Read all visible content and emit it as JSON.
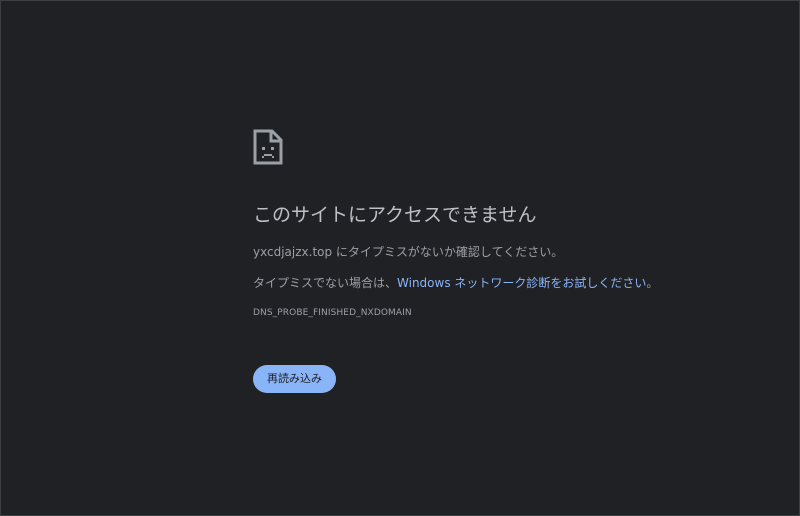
{
  "error": {
    "icon": "sad-document-icon",
    "title": "このサイトにアクセスできません",
    "message_domain": "yxcdjajzx.top",
    "message_suffix": " にタイプミスがないか確認してください。",
    "hint_prefix": "タイプミスでない場合は、",
    "hint_link": "Windows ネットワーク診断をお試しください",
    "hint_suffix": "。",
    "error_code": "DNS_PROBE_FINISHED_NXDOMAIN"
  },
  "actions": {
    "reload_label": "再読み込み"
  },
  "colors": {
    "background": "#202124",
    "text": "#9aa0a6",
    "title": "#bdc1c6",
    "link": "#8ab4f8",
    "button": "#8ab4f8"
  }
}
